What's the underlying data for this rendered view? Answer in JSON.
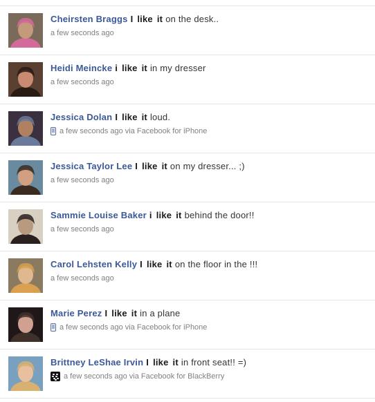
{
  "stories": [
    {
      "name": "Cheirsten Braggs",
      "subject": "I",
      "verb": "like",
      "object": "it",
      "rest": "on the desk..",
      "time": "a few seconds ago",
      "via": "",
      "source_icon": "",
      "avatar_colors": [
        "#7a6a5a",
        "#c49a7a",
        "#d46a9a"
      ]
    },
    {
      "name": "Heidi Meincke",
      "subject": "i",
      "verb": "like",
      "object": "it",
      "rest": "in my dresser",
      "time": "a few seconds ago",
      "via": "",
      "source_icon": "",
      "avatar_colors": [
        "#5a4030",
        "#c88a70",
        "#2a1a14"
      ]
    },
    {
      "name": "Jessica Dolan",
      "subject": "I",
      "verb": "like",
      "object": "it",
      "rest": "loud.",
      "time": "a few seconds ago via Facebook for iPhone",
      "via": "",
      "source_icon": "phone-icon",
      "avatar_colors": [
        "#3a3040",
        "#b08060",
        "#6a7a9a"
      ]
    },
    {
      "name": "Jessica Taylor Lee",
      "subject": "I",
      "verb": "like",
      "object": "it",
      "rest": "on my dresser... ;)",
      "time": "a few seconds ago",
      "via": "",
      "source_icon": "",
      "avatar_colors": [
        "#6a8aa0",
        "#d0a080",
        "#3a2a20"
      ]
    },
    {
      "name": "Sammie Louise Baker",
      "subject": "i",
      "verb": "like",
      "object": "it",
      "rest": "behind the door!!",
      "time": "a few seconds ago",
      "via": "",
      "source_icon": "",
      "avatar_colors": [
        "#d8d0c0",
        "#b89a80",
        "#2a2020"
      ]
    },
    {
      "name": "Carol Lehsten Kelly",
      "subject": "I",
      "verb": "like",
      "object": "it",
      "rest": "on the floor in the !!!",
      "time": "a few seconds ago",
      "via": "",
      "source_icon": "",
      "avatar_colors": [
        "#8a7a60",
        "#e0b890",
        "#d8a050"
      ]
    },
    {
      "name": "Marie Perez",
      "subject": "I",
      "verb": "like",
      "object": "it",
      "rest": "in a plane",
      "time": "a few seconds ago via Facebook for iPhone",
      "via": "",
      "source_icon": "phone-icon",
      "avatar_colors": [
        "#201818",
        "#d0a090",
        "#40302a"
      ]
    },
    {
      "name": "Brittney LeShae Irvin",
      "subject": "I",
      "verb": "like",
      "object": "it",
      "rest": "in front seat!! =)",
      "time": "a few seconds ago via Facebook for BlackBerry",
      "via": "",
      "source_icon": "blackberry-icon",
      "avatar_colors": [
        "#7aa0c0",
        "#e8c0a0",
        "#d8b070"
      ]
    }
  ]
}
